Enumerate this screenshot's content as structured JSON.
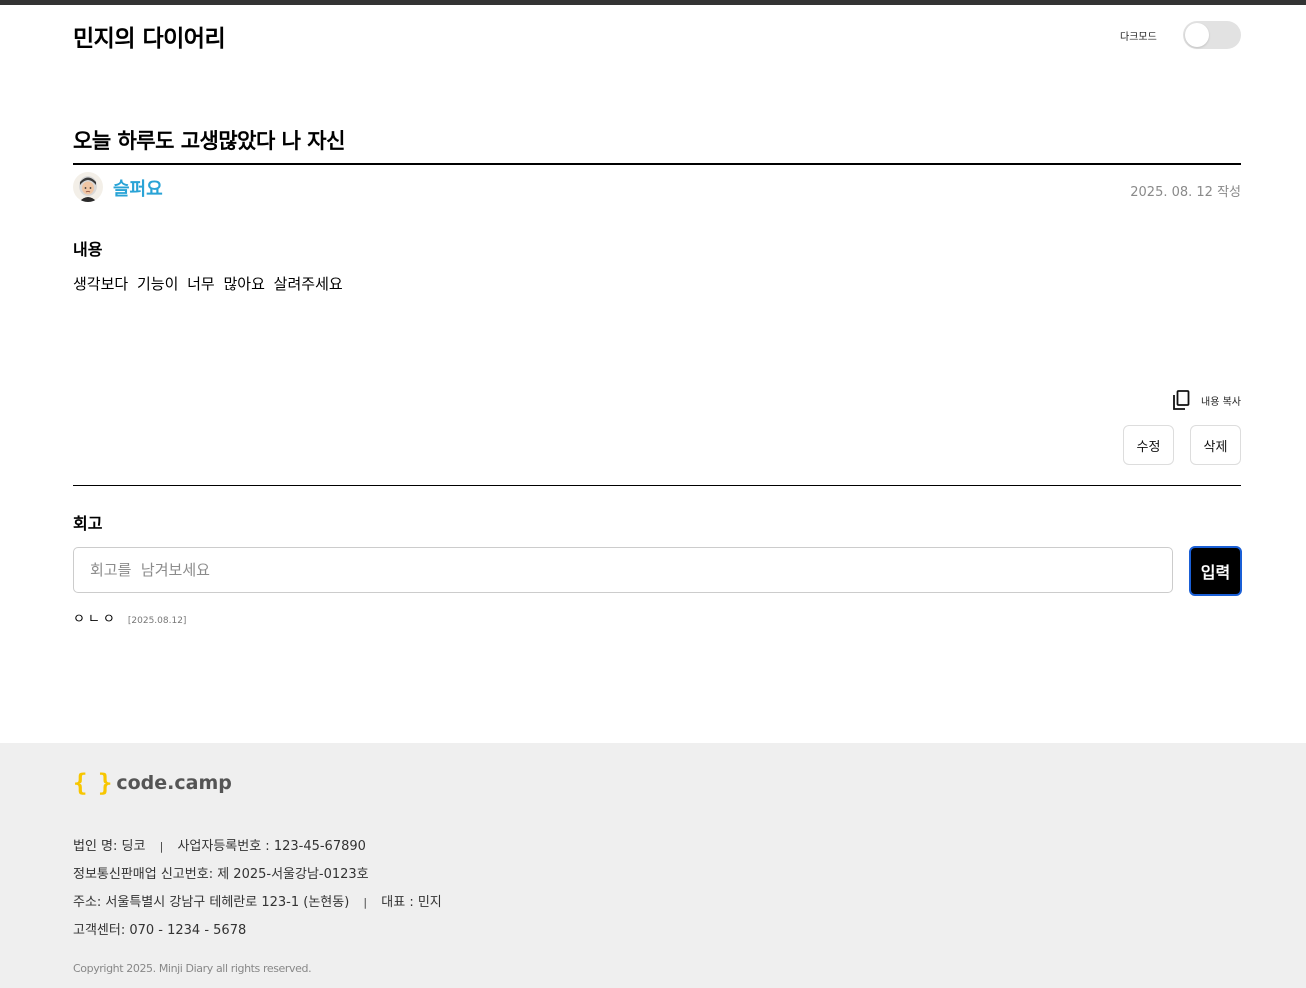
{
  "header": {
    "site_title": "민지의 다이어리",
    "dark_mode_label": "다크모드",
    "dark_mode_enabled": false
  },
  "diary": {
    "title": "오늘 하루도 고생많았다 나 자신",
    "mood": "슬퍼요",
    "mood_color": "#29a3d6",
    "date": "2025. 08. 12  작성",
    "content_label": "내용",
    "content": "생각보다 기능이 너무 많아요 살려주세요",
    "copy_label": "내용 복사",
    "edit_label": "수정",
    "delete_label": "삭제"
  },
  "review": {
    "section_label": "회고",
    "input_placeholder": "회고를  남겨보세요",
    "submit_label": "입력",
    "items": [
      {
        "text": "ㅇㄴㅇ",
        "date": "[2025.08.12]"
      }
    ]
  },
  "footer": {
    "logo_brace": "{ }",
    "logo_text": "code.camp",
    "company_name": "법인 명: 딩코",
    "business_number": "사업자등록번호 : 123-45-67890",
    "ecommerce_number": "정보통신판매업 신고번호: 제 2025-서울강남-0123호",
    "address": "주소: 서울특별시 강남구 테헤란로 123-1 (논현동)",
    "ceo": "대표 : 민지",
    "customer_center": "고객센터: 070 - 1234 - 5678",
    "separator": "|",
    "copyright": "Copyright 2025. Minji Diary all rights reserved.",
    "accent_color": "#f7c600"
  }
}
